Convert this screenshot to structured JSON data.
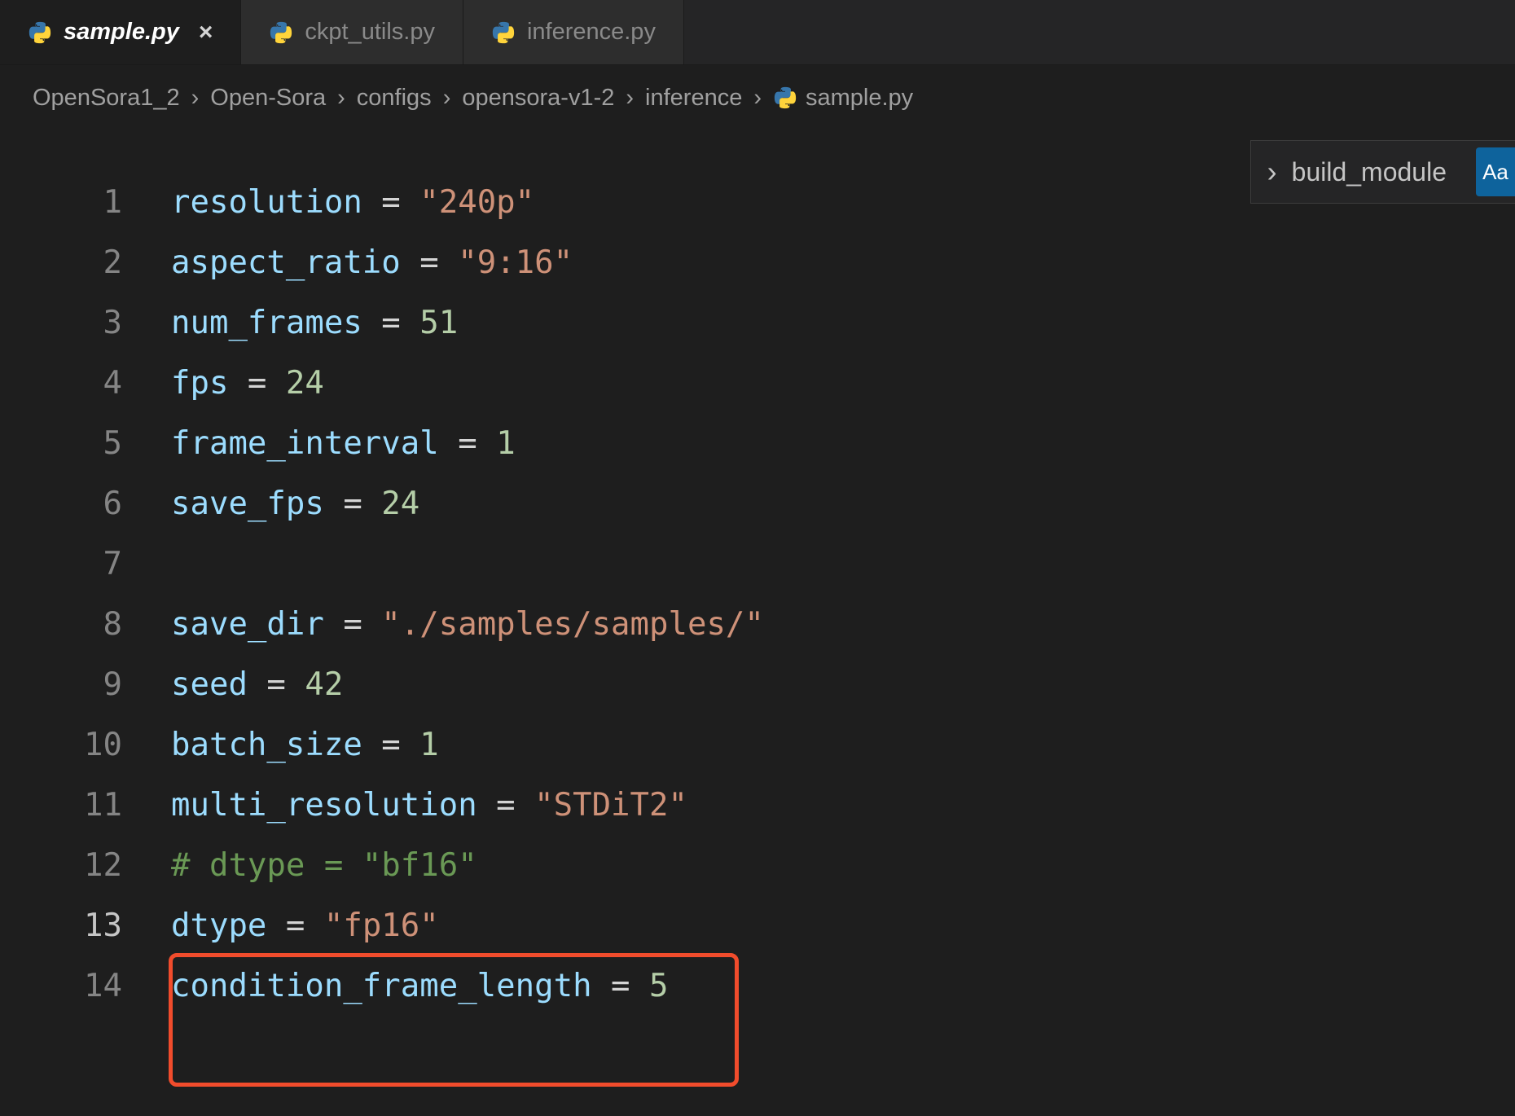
{
  "tabs": [
    {
      "label": "sample.py",
      "active": true
    },
    {
      "label": "ckpt_utils.py",
      "active": false
    },
    {
      "label": "inference.py",
      "active": false
    }
  ],
  "breadcrumb": {
    "parts": [
      "OpenSora1_2",
      "Open-Sora",
      "configs",
      "opensora-v1-2",
      "inference"
    ],
    "file": "sample.py"
  },
  "nav": {
    "symbol": "build_module",
    "aa": "Aa"
  },
  "lines": {
    "l1": {
      "var": "resolution",
      "val": "\"240p\"",
      "kind": "str"
    },
    "l2": {
      "var": "aspect_ratio",
      "val": "\"9:16\"",
      "kind": "str"
    },
    "l3": {
      "var": "num_frames",
      "val": "51",
      "kind": "num"
    },
    "l4": {
      "var": "fps",
      "val": "24",
      "kind": "num"
    },
    "l5": {
      "var": "frame_interval",
      "val": "1",
      "kind": "num"
    },
    "l6": {
      "var": "save_fps",
      "val": "24",
      "kind": "num"
    },
    "l8": {
      "var": "save_dir",
      "val": "\"./samples/samples/\"",
      "kind": "str"
    },
    "l9": {
      "var": "seed",
      "val": "42",
      "kind": "num"
    },
    "l10": {
      "var": "batch_size",
      "val": "1",
      "kind": "num"
    },
    "l11": {
      "var": "multi_resolution",
      "val": "\"STDiT2\"",
      "kind": "str"
    },
    "l12": {
      "comment": "# dtype = \"bf16\""
    },
    "l13": {
      "var": "dtype",
      "val": "\"fp16\"",
      "kind": "str"
    },
    "l14": {
      "var": "condition_frame_length",
      "val": "5",
      "kind": "num"
    }
  },
  "ln": {
    "1": "1",
    "2": "2",
    "3": "3",
    "4": "4",
    "5": "5",
    "6": "6",
    "7": "7",
    "8": "8",
    "9": "9",
    "10": "10",
    "11": "11",
    "12": "12",
    "13": "13",
    "14": "14"
  },
  "colors": {
    "highlight_border": "#f14c2c"
  }
}
